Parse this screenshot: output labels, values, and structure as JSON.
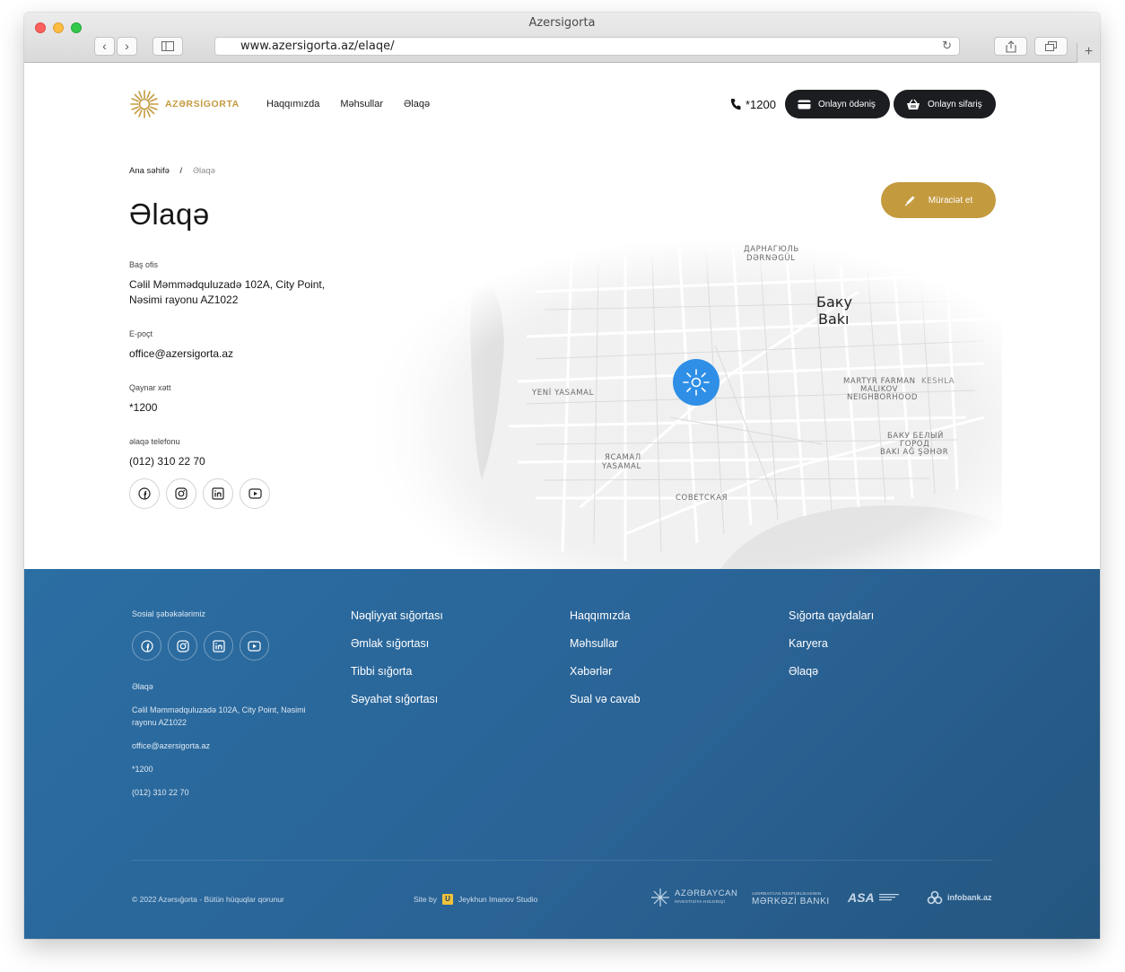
{
  "browser": {
    "window_title": "Azersigorta",
    "url": "www.azersigorta.az/elaqe/"
  },
  "header": {
    "logo_text": "AZƏRSİGORTA",
    "nav": [
      "Haqqımızda",
      "Məhsullar",
      "Əlaqə"
    ],
    "phone": "*1200",
    "pay_label": "Onlayn ödəniş",
    "order_label": "Onlayn sifariş"
  },
  "breadcrumb": {
    "home": "Ana səhifə",
    "separator": "/",
    "current": "Əlaqə"
  },
  "page_title": "Əlaqə",
  "apply_button": "Müraciət et",
  "contact": {
    "office_label": "Baş ofis",
    "office_line1": "Cəlil Məmmədquluzadə 102A, City Point,",
    "office_line2": "Nəsimi rayonu AZ1022",
    "email_label": "E-poçt",
    "email": "office@azersigorta.az",
    "hotline_label": "Qaynar xətt",
    "hotline": "*1200",
    "phone_label": "əlaqə telefonu",
    "phone": "(012) 310 22 70"
  },
  "socials": [
    "facebook-icon",
    "instagram-icon",
    "linkedin-icon",
    "youtube-icon"
  ],
  "map": {
    "labels": {
      "darnagul": "ДАРНАГЮЛЬ",
      "darnagul_az": "DƏRNƏGÜL",
      "baku_ru": "Баку",
      "baku_az": "Bakı",
      "yeni_yasamal": "YENİ YASAMAL",
      "martyr1": "MARTYR FARMAN",
      "martyr2": "MALIKOV",
      "martyr3": "NEIGHBORHOOD",
      "keshla": "KESHLA",
      "yasamal_ru": "ЯСАМАЛ",
      "yasamal_az": "YASAMAL",
      "white_city1": "БАКУ БЕЛЫЙ",
      "white_city2": "ГОРОД",
      "white_city3": "BAKI AĞ ŞƏHƏR",
      "sovetskaya": "СОВЕТСКАЯ"
    }
  },
  "footer": {
    "social_title": "Sosial şəbəkələrimiz",
    "contact_title": "Əlaqə",
    "address": "Cəlil Məmmədquluzadə 102A, City Point, Nəsimi rayonu AZ1022",
    "email": "office@azersigorta.az",
    "hotline": "*1200",
    "phone": "(012) 310 22 70",
    "col1": [
      "Nəqliyyat sığortası",
      "Əmlak sığortası",
      "Tibbi sığorta",
      "Səyahət sığortası"
    ],
    "col2": [
      "Haqqımızda",
      "Məhsullar",
      "Xəbərlər",
      "Sual və cavab"
    ],
    "col3": [
      "Sığorta qaydaları",
      "Karyera",
      "Əlaqə"
    ],
    "copyright": "© 2022 Azərsığorta - Bütün hüquqlar qorunur",
    "site_by": "Site by",
    "studio": "Jeykhun Imanov Studio",
    "partners": {
      "p1_line1": "AZƏRBAYCAN",
      "p1_line2": "İNVESTİSİYA HOLDİNQİ",
      "p2_line1": "AZƏRBAYCAN RESPUBLİKASININ",
      "p2_line2": "MƏRKƏZİ BANKI",
      "p3": "ASA",
      "p4": "infobank.az"
    }
  },
  "colors": {
    "gold": "#c49a3f",
    "dark_button": "#1c1d21",
    "footer_blue": "#2a6396",
    "marker_blue": "#2f8fe6"
  }
}
